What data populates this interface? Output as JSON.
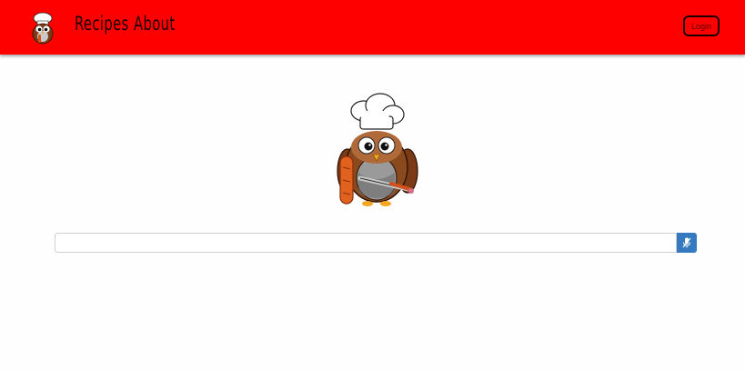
{
  "navbar": {
    "color": "#ff0000",
    "logo_icon": "chef-owl-logo-icon",
    "links": [
      {
        "label": "Recipes"
      },
      {
        "label": "About"
      }
    ],
    "login_label": "Login"
  },
  "hero": {
    "icon": "chef-owl-with-sausage-mascot-icon"
  },
  "search": {
    "value": "",
    "placeholder": "",
    "button_icon": "microphone-mute-icon",
    "button_color": "#3579c0"
  }
}
